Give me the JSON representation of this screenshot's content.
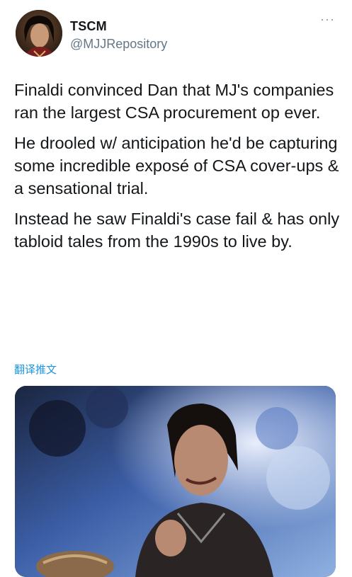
{
  "tweet": {
    "author_name": "TSCM",
    "author_handle": "@MJJRepository",
    "more_glyph": "···",
    "paragraphs": [
      "Finaldi convinced Dan that MJ's companies ran the largest CSA procurement op ever.",
      "He drooled w/ anticipation he'd be capturing some incredible exposé of CSA cover-ups & a sensational trial.",
      "Instead he saw Finaldi's case fail & has only tabloid tales from the 1990s to live by."
    ],
    "translate_label": "翻译推文"
  },
  "icons": {
    "more": "more-options-icon",
    "avatar": "profile-photo"
  },
  "colors": {
    "text": "#14171a",
    "secondary": "#657786",
    "link": "#1b95e0"
  }
}
